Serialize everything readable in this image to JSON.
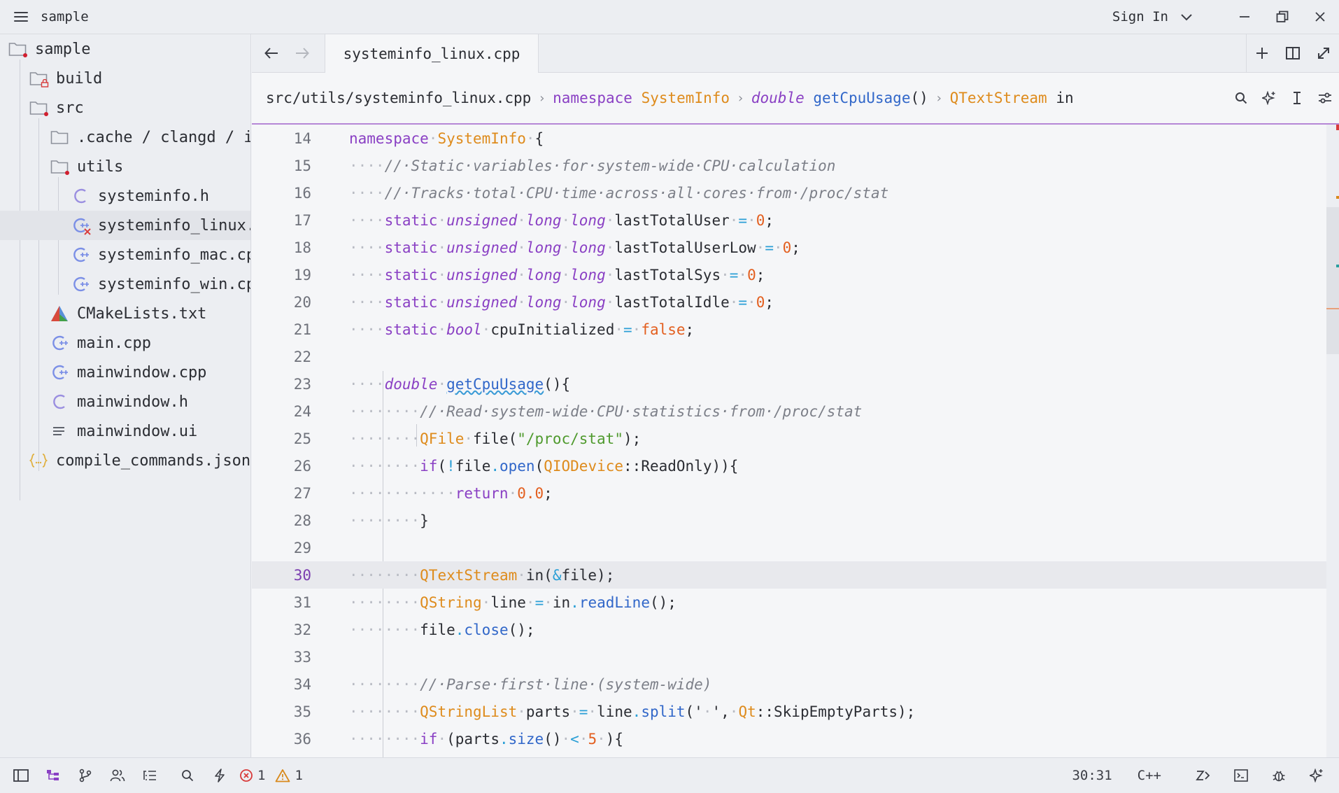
{
  "titlebar": {
    "project": "sample",
    "signin": "Sign In"
  },
  "sidebar": {
    "items": [
      {
        "label": "sample",
        "icon": "folder-open-icon",
        "depth": 0
      },
      {
        "label": "build",
        "icon": "folder-lock-icon",
        "depth": 1
      },
      {
        "label": "src",
        "icon": "folder-open-icon",
        "depth": 1
      },
      {
        "label": ".cache / clangd / index",
        "icon": "folder-icon",
        "depth": 2
      },
      {
        "label": "utils",
        "icon": "folder-open-icon",
        "depth": 2
      },
      {
        "label": "systeminfo.h",
        "icon": "c-header-icon",
        "depth": 3
      },
      {
        "label": "systeminfo_linux.cpp",
        "icon": "cpp-file-icon",
        "depth": 3
      },
      {
        "label": "systeminfo_mac.cpp",
        "icon": "cpp-file-icon",
        "depth": 3
      },
      {
        "label": "systeminfo_win.cpp",
        "icon": "cpp-file-icon",
        "depth": 3
      },
      {
        "label": "CMakeLists.txt",
        "icon": "cmake-icon",
        "depth": 2
      },
      {
        "label": "main.cpp",
        "icon": "cpp-file-icon",
        "depth": 2
      },
      {
        "label": "mainwindow.cpp",
        "icon": "cpp-file-icon",
        "depth": 2
      },
      {
        "label": "mainwindow.h",
        "icon": "c-header-icon",
        "depth": 2
      },
      {
        "label": "mainwindow.ui",
        "icon": "lines-icon",
        "depth": 2
      },
      {
        "label": "compile_commands.json",
        "icon": "json-icon",
        "depth": 1
      }
    ]
  },
  "tab": {
    "label": "systeminfo_linux.cpp"
  },
  "breadcrumb": {
    "path": "src/utils/systeminfo_linux.cpp",
    "ns_kw": "namespace",
    "ns_name": "SystemInfo",
    "fn_type": "double",
    "fn_name": "getCpuUsage",
    "fn_parens": "()",
    "var_type": "QTextStream",
    "var_name": "in"
  },
  "editor": {
    "active_line": 30,
    "lines": [
      {
        "n": "14",
        "tokens": [
          [
            "kw",
            "namespace"
          ],
          [
            "ws",
            "·"
          ],
          [
            "cl",
            "SystemInfo"
          ],
          [
            "ws",
            "·"
          ],
          [
            "pl",
            "{"
          ]
        ]
      },
      {
        "n": "15",
        "tokens": [
          [
            "ws",
            "····"
          ],
          [
            "cm",
            "//·Static·variables·for·system-wide·CPU·calculation"
          ]
        ]
      },
      {
        "n": "16",
        "tokens": [
          [
            "ws",
            "····"
          ],
          [
            "cm",
            "//·Tracks·total·CPU·time·across·all·cores·from·/proc/stat"
          ]
        ]
      },
      {
        "n": "17",
        "tokens": [
          [
            "ws",
            "····"
          ],
          [
            "kw",
            "static"
          ],
          [
            "ws",
            "·"
          ],
          [
            "ty",
            "unsigned"
          ],
          [
            "ws",
            "·"
          ],
          [
            "ty",
            "long"
          ],
          [
            "ws",
            "·"
          ],
          [
            "ty",
            "long"
          ],
          [
            "ws",
            "·"
          ],
          [
            "pl",
            "lastTotalUser"
          ],
          [
            "ws",
            "·"
          ],
          [
            "op",
            "="
          ],
          [
            "ws",
            "·"
          ],
          [
            "num",
            "0"
          ],
          [
            "pl",
            ";"
          ]
        ]
      },
      {
        "n": "18",
        "tokens": [
          [
            "ws",
            "····"
          ],
          [
            "kw",
            "static"
          ],
          [
            "ws",
            "·"
          ],
          [
            "ty",
            "unsigned"
          ],
          [
            "ws",
            "·"
          ],
          [
            "ty",
            "long"
          ],
          [
            "ws",
            "·"
          ],
          [
            "ty",
            "long"
          ],
          [
            "ws",
            "·"
          ],
          [
            "pl",
            "lastTotalUserLow"
          ],
          [
            "ws",
            "·"
          ],
          [
            "op",
            "="
          ],
          [
            "ws",
            "·"
          ],
          [
            "num",
            "0"
          ],
          [
            "pl",
            ";"
          ]
        ]
      },
      {
        "n": "19",
        "tokens": [
          [
            "ws",
            "····"
          ],
          [
            "kw",
            "static"
          ],
          [
            "ws",
            "·"
          ],
          [
            "ty",
            "unsigned"
          ],
          [
            "ws",
            "·"
          ],
          [
            "ty",
            "long"
          ],
          [
            "ws",
            "·"
          ],
          [
            "ty",
            "long"
          ],
          [
            "ws",
            "·"
          ],
          [
            "pl",
            "lastTotalSys"
          ],
          [
            "ws",
            "·"
          ],
          [
            "op",
            "="
          ],
          [
            "ws",
            "·"
          ],
          [
            "num",
            "0"
          ],
          [
            "pl",
            ";"
          ]
        ]
      },
      {
        "n": "20",
        "tokens": [
          [
            "ws",
            "····"
          ],
          [
            "kw",
            "static"
          ],
          [
            "ws",
            "·"
          ],
          [
            "ty",
            "unsigned"
          ],
          [
            "ws",
            "·"
          ],
          [
            "ty",
            "long"
          ],
          [
            "ws",
            "·"
          ],
          [
            "ty",
            "long"
          ],
          [
            "ws",
            "·"
          ],
          [
            "pl",
            "lastTotalIdle"
          ],
          [
            "ws",
            "·"
          ],
          [
            "op",
            "="
          ],
          [
            "ws",
            "·"
          ],
          [
            "num",
            "0"
          ],
          [
            "pl",
            ";"
          ]
        ]
      },
      {
        "n": "21",
        "tokens": [
          [
            "ws",
            "····"
          ],
          [
            "kw",
            "static"
          ],
          [
            "ws",
            "·"
          ],
          [
            "ty",
            "bool"
          ],
          [
            "ws",
            "·"
          ],
          [
            "pl",
            "cpuInitialized"
          ],
          [
            "ws",
            "·"
          ],
          [
            "op",
            "="
          ],
          [
            "ws",
            "·"
          ],
          [
            "num",
            "false"
          ],
          [
            "pl",
            ";"
          ]
        ]
      },
      {
        "n": "22",
        "tokens": []
      },
      {
        "n": "23",
        "tokens": [
          [
            "ws",
            "····"
          ],
          [
            "ty",
            "double"
          ],
          [
            "ws",
            "·"
          ],
          [
            "fn",
            "getCpuUsage"
          ],
          [
            "pl",
            "(){"
          ]
        ]
      },
      {
        "n": "24",
        "tokens": [
          [
            "ws",
            "········"
          ],
          [
            "cm",
            "//·Read·system-wide·CPU·statistics·from·/proc/stat"
          ]
        ]
      },
      {
        "n": "25",
        "tokens": [
          [
            "ws",
            "········"
          ],
          [
            "cl",
            "QFile"
          ],
          [
            "ws",
            "·"
          ],
          [
            "pl",
            "file("
          ],
          [
            "str",
            "\"/proc/stat\""
          ],
          [
            "pl",
            ");"
          ]
        ]
      },
      {
        "n": "26",
        "tokens": [
          [
            "ws",
            "········"
          ],
          [
            "kw",
            "if"
          ],
          [
            "pl",
            "("
          ],
          [
            "op",
            "!"
          ],
          [
            "pl",
            "file"
          ],
          [
            "op",
            "."
          ],
          [
            "fn",
            "open"
          ],
          [
            "pl",
            "("
          ],
          [
            "cl",
            "QIODevice"
          ],
          [
            "pl",
            "::ReadOnly)){"
          ]
        ]
      },
      {
        "n": "27",
        "tokens": [
          [
            "ws",
            "············"
          ],
          [
            "kw",
            "return"
          ],
          [
            "ws",
            "·"
          ],
          [
            "num",
            "0.0"
          ],
          [
            "pl",
            ";"
          ]
        ]
      },
      {
        "n": "28",
        "tokens": [
          [
            "ws",
            "········"
          ],
          [
            "pl",
            "}"
          ]
        ]
      },
      {
        "n": "29",
        "tokens": []
      },
      {
        "n": "30",
        "tokens": [
          [
            "ws",
            "········"
          ],
          [
            "cl",
            "QTextStream"
          ],
          [
            "ws",
            "·"
          ],
          [
            "pl",
            "in("
          ],
          [
            "op",
            "&"
          ],
          [
            "pl",
            "file);"
          ]
        ]
      },
      {
        "n": "31",
        "tokens": [
          [
            "ws",
            "········"
          ],
          [
            "cl",
            "QString"
          ],
          [
            "ws",
            "·"
          ],
          [
            "pl",
            "line"
          ],
          [
            "ws",
            "·"
          ],
          [
            "op",
            "="
          ],
          [
            "ws",
            "·"
          ],
          [
            "pl",
            "in"
          ],
          [
            "op",
            "."
          ],
          [
            "fn",
            "readLine"
          ],
          [
            "pl",
            "();"
          ]
        ]
      },
      {
        "n": "32",
        "tokens": [
          [
            "ws",
            "········"
          ],
          [
            "pl",
            "file"
          ],
          [
            "op",
            "."
          ],
          [
            "fn",
            "close"
          ],
          [
            "pl",
            "();"
          ]
        ]
      },
      {
        "n": "33",
        "tokens": []
      },
      {
        "n": "34",
        "tokens": [
          [
            "ws",
            "········"
          ],
          [
            "cm",
            "//·Parse·first·line·(system-wide)"
          ]
        ]
      },
      {
        "n": "35",
        "tokens": [
          [
            "ws",
            "········"
          ],
          [
            "cl",
            "QStringList"
          ],
          [
            "ws",
            "·"
          ],
          [
            "pl",
            "parts"
          ],
          [
            "ws",
            "·"
          ],
          [
            "op",
            "="
          ],
          [
            "ws",
            "·"
          ],
          [
            "pl",
            "line"
          ],
          [
            "op",
            "."
          ],
          [
            "fn",
            "split"
          ],
          [
            "pl",
            "('"
          ],
          [
            "ws",
            "·"
          ],
          [
            "pl",
            "',"
          ],
          [
            "ws",
            "·"
          ],
          [
            "cl",
            "Qt"
          ],
          [
            "pl",
            "::SkipEmptyParts);"
          ]
        ]
      },
      {
        "n": "36",
        "tokens": [
          [
            "ws",
            "········"
          ],
          [
            "kw",
            "if"
          ],
          [
            "ws",
            "·"
          ],
          [
            "pl",
            "(parts"
          ],
          [
            "op",
            "."
          ],
          [
            "fn",
            "size"
          ],
          [
            "pl",
            "()"
          ],
          [
            "ws",
            "·"
          ],
          [
            "op",
            "<"
          ],
          [
            "ws",
            "·"
          ],
          [
            "num",
            "5"
          ],
          [
            "ws",
            "·"
          ],
          [
            "pl",
            "){"
          ]
        ]
      }
    ]
  },
  "status": {
    "errors": "1",
    "warnings": "1",
    "cursor": "30:31",
    "language": "C++"
  },
  "colors": {
    "accent": "#8a40c4",
    "error": "#d83b3b",
    "warning": "#d98a1c"
  }
}
